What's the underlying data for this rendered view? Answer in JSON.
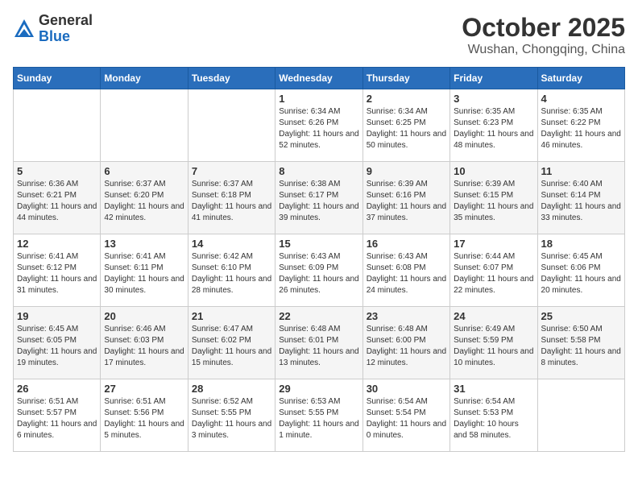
{
  "logo": {
    "general": "General",
    "blue": "Blue"
  },
  "title": "October 2025",
  "location": "Wushan, Chongqing, China",
  "days_of_week": [
    "Sunday",
    "Monday",
    "Tuesday",
    "Wednesday",
    "Thursday",
    "Friday",
    "Saturday"
  ],
  "weeks": [
    [
      {
        "day": "",
        "info": ""
      },
      {
        "day": "",
        "info": ""
      },
      {
        "day": "",
        "info": ""
      },
      {
        "day": "1",
        "info": "Sunrise: 6:34 AM\nSunset: 6:26 PM\nDaylight: 11 hours and 52 minutes."
      },
      {
        "day": "2",
        "info": "Sunrise: 6:34 AM\nSunset: 6:25 PM\nDaylight: 11 hours and 50 minutes."
      },
      {
        "day": "3",
        "info": "Sunrise: 6:35 AM\nSunset: 6:23 PM\nDaylight: 11 hours and 48 minutes."
      },
      {
        "day": "4",
        "info": "Sunrise: 6:35 AM\nSunset: 6:22 PM\nDaylight: 11 hours and 46 minutes."
      }
    ],
    [
      {
        "day": "5",
        "info": "Sunrise: 6:36 AM\nSunset: 6:21 PM\nDaylight: 11 hours and 44 minutes."
      },
      {
        "day": "6",
        "info": "Sunrise: 6:37 AM\nSunset: 6:20 PM\nDaylight: 11 hours and 42 minutes."
      },
      {
        "day": "7",
        "info": "Sunrise: 6:37 AM\nSunset: 6:18 PM\nDaylight: 11 hours and 41 minutes."
      },
      {
        "day": "8",
        "info": "Sunrise: 6:38 AM\nSunset: 6:17 PM\nDaylight: 11 hours and 39 minutes."
      },
      {
        "day": "9",
        "info": "Sunrise: 6:39 AM\nSunset: 6:16 PM\nDaylight: 11 hours and 37 minutes."
      },
      {
        "day": "10",
        "info": "Sunrise: 6:39 AM\nSunset: 6:15 PM\nDaylight: 11 hours and 35 minutes."
      },
      {
        "day": "11",
        "info": "Sunrise: 6:40 AM\nSunset: 6:14 PM\nDaylight: 11 hours and 33 minutes."
      }
    ],
    [
      {
        "day": "12",
        "info": "Sunrise: 6:41 AM\nSunset: 6:12 PM\nDaylight: 11 hours and 31 minutes."
      },
      {
        "day": "13",
        "info": "Sunrise: 6:41 AM\nSunset: 6:11 PM\nDaylight: 11 hours and 30 minutes."
      },
      {
        "day": "14",
        "info": "Sunrise: 6:42 AM\nSunset: 6:10 PM\nDaylight: 11 hours and 28 minutes."
      },
      {
        "day": "15",
        "info": "Sunrise: 6:43 AM\nSunset: 6:09 PM\nDaylight: 11 hours and 26 minutes."
      },
      {
        "day": "16",
        "info": "Sunrise: 6:43 AM\nSunset: 6:08 PM\nDaylight: 11 hours and 24 minutes."
      },
      {
        "day": "17",
        "info": "Sunrise: 6:44 AM\nSunset: 6:07 PM\nDaylight: 11 hours and 22 minutes."
      },
      {
        "day": "18",
        "info": "Sunrise: 6:45 AM\nSunset: 6:06 PM\nDaylight: 11 hours and 20 minutes."
      }
    ],
    [
      {
        "day": "19",
        "info": "Sunrise: 6:45 AM\nSunset: 6:05 PM\nDaylight: 11 hours and 19 minutes."
      },
      {
        "day": "20",
        "info": "Sunrise: 6:46 AM\nSunset: 6:03 PM\nDaylight: 11 hours and 17 minutes."
      },
      {
        "day": "21",
        "info": "Sunrise: 6:47 AM\nSunset: 6:02 PM\nDaylight: 11 hours and 15 minutes."
      },
      {
        "day": "22",
        "info": "Sunrise: 6:48 AM\nSunset: 6:01 PM\nDaylight: 11 hours and 13 minutes."
      },
      {
        "day": "23",
        "info": "Sunrise: 6:48 AM\nSunset: 6:00 PM\nDaylight: 11 hours and 12 minutes."
      },
      {
        "day": "24",
        "info": "Sunrise: 6:49 AM\nSunset: 5:59 PM\nDaylight: 11 hours and 10 minutes."
      },
      {
        "day": "25",
        "info": "Sunrise: 6:50 AM\nSunset: 5:58 PM\nDaylight: 11 hours and 8 minutes."
      }
    ],
    [
      {
        "day": "26",
        "info": "Sunrise: 6:51 AM\nSunset: 5:57 PM\nDaylight: 11 hours and 6 minutes."
      },
      {
        "day": "27",
        "info": "Sunrise: 6:51 AM\nSunset: 5:56 PM\nDaylight: 11 hours and 5 minutes."
      },
      {
        "day": "28",
        "info": "Sunrise: 6:52 AM\nSunset: 5:55 PM\nDaylight: 11 hours and 3 minutes."
      },
      {
        "day": "29",
        "info": "Sunrise: 6:53 AM\nSunset: 5:55 PM\nDaylight: 11 hours and 1 minute."
      },
      {
        "day": "30",
        "info": "Sunrise: 6:54 AM\nSunset: 5:54 PM\nDaylight: 11 hours and 0 minutes."
      },
      {
        "day": "31",
        "info": "Sunrise: 6:54 AM\nSunset: 5:53 PM\nDaylight: 10 hours and 58 minutes."
      },
      {
        "day": "",
        "info": ""
      }
    ]
  ]
}
